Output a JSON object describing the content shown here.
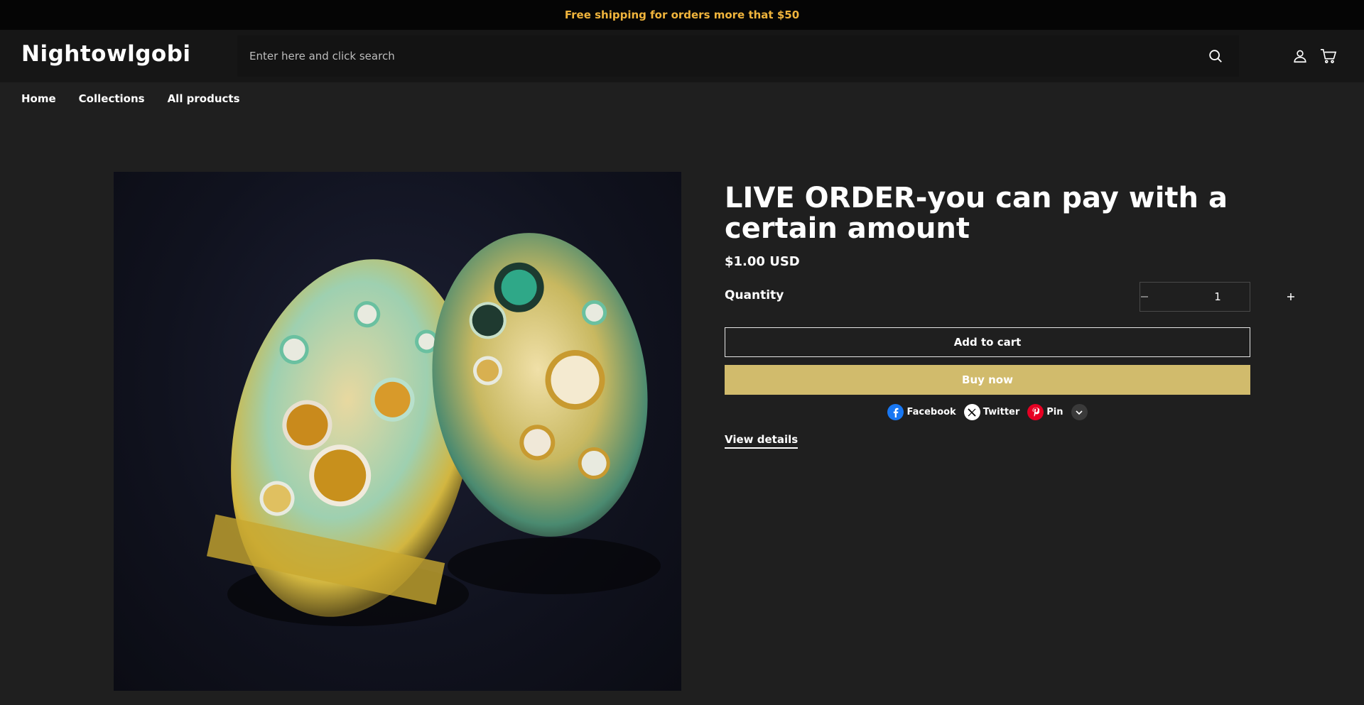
{
  "announcement": {
    "text": "Free shipping for orders more that $50"
  },
  "header": {
    "logo": "Nightowlgobi",
    "search_placeholder": "Enter here and click search"
  },
  "nav": {
    "items": [
      "Home",
      "Collections",
      "All products"
    ]
  },
  "product": {
    "title": "LIVE ORDER-you can pay with a certain amount",
    "price": "$1.00 USD",
    "quantity_label": "Quantity",
    "quantity_value": "1",
    "add_to_cart": "Add to cart",
    "buy_now": "Buy now",
    "view_details": "View details"
  },
  "share": {
    "facebook": "Facebook",
    "twitter": "Twitter",
    "pin": "Pin"
  },
  "colors": {
    "announcement_text": "#f0b43c",
    "buy_button": "#d1bb6c",
    "facebook": "#1877f2",
    "pinterest": "#e60023"
  }
}
